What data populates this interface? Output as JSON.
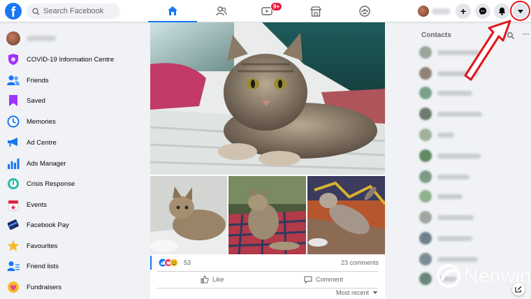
{
  "search": {
    "placeholder": "Search Facebook"
  },
  "header": {
    "watch_badge": "9+",
    "logo_letter": "f",
    "create_symbol": "+"
  },
  "sidebar": {
    "items": [
      {
        "label": "COVID-19 Information Centre",
        "icon": "covid-shield-icon",
        "color": "#a033ff"
      },
      {
        "label": "Friends",
        "icon": "friends-icon",
        "color": "#1877f2"
      },
      {
        "label": "Saved",
        "icon": "bookmark-icon",
        "color": "#a033ff"
      },
      {
        "label": "Memories",
        "icon": "clock-icon",
        "color": "#1877f2"
      },
      {
        "label": "Ad Centre",
        "icon": "megaphone-icon",
        "color": "#1877f2"
      },
      {
        "label": "Ads Manager",
        "icon": "bar-chart-icon",
        "color": "#1877f2"
      },
      {
        "label": "Crisis Response",
        "icon": "crisis-icon",
        "color": "#2abba7"
      },
      {
        "label": "Events",
        "icon": "calendar-icon",
        "color": "#e41e3f"
      },
      {
        "label": "Facebook Pay",
        "icon": "pay-card-icon",
        "color": "#1c2b6b"
      },
      {
        "label": "Favourites",
        "icon": "star-icon",
        "color": "#f7b928"
      },
      {
        "label": "Friend lists",
        "icon": "friend-list-icon",
        "color": "#1877f2"
      },
      {
        "label": "Fundraisers",
        "icon": "heart-icon",
        "color": "#e4488a"
      }
    ]
  },
  "post": {
    "reaction_count": "53",
    "comments_label": "23 comments",
    "like_label": "Like",
    "comment_label": "Comment",
    "sort_label": "Most recent"
  },
  "contacts": {
    "title": "Contacts"
  },
  "watermark": {
    "text": "Neowin"
  },
  "colors": {
    "brand": "#1877f2",
    "highlight": "#e0161c"
  }
}
